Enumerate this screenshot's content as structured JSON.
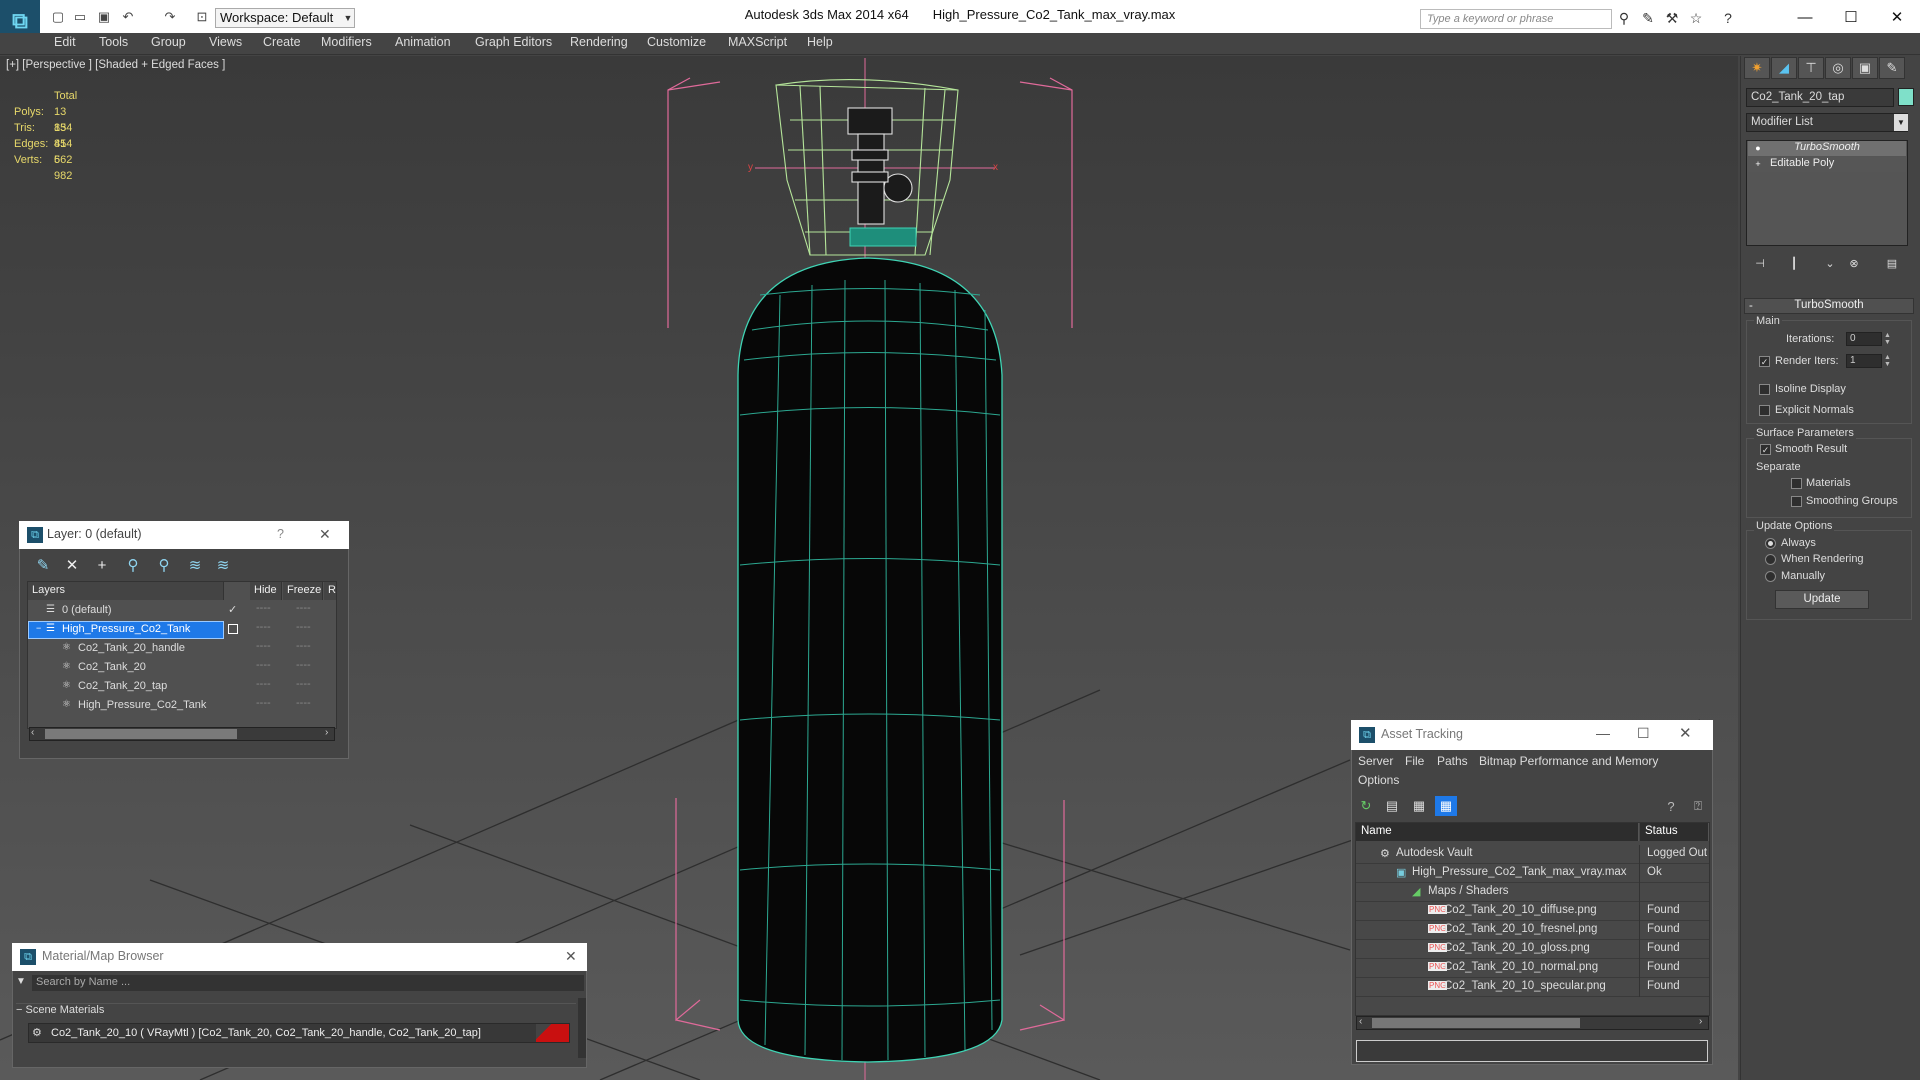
{
  "titlebar": {
    "app_title": "Autodesk 3ds Max  2014 x64",
    "file_name": "High_Pressure_Co2_Tank_max_vray.max",
    "workspace": "Workspace: Default",
    "search_placeholder": "Type a keyword or phrase"
  },
  "menu": [
    "Edit",
    "Tools",
    "Group",
    "Views",
    "Create",
    "Modifiers",
    "Animation",
    "Graph Editors",
    "Rendering",
    "Customize",
    "MAXScript",
    "Help"
  ],
  "viewport": {
    "label": "[+] [Perspective ] [Shaded + Edged Faces ]",
    "stats": {
      "header": "Total",
      "rows": [
        {
          "k": "Polys:",
          "v": "13 854"
        },
        {
          "k": "Tris:",
          "v": "13 854"
        },
        {
          "k": "Edges:",
          "v": "41 562"
        },
        {
          "k": "Verts:",
          "v": "6 982"
        }
      ]
    }
  },
  "command_panel": {
    "object_name": "Co2_Tank_20_tap",
    "object_color": "#7fe0c9",
    "modifier_list": "Modifier List",
    "stack": [
      "TurboSmooth",
      "Editable Poly"
    ],
    "rollout": "TurboSmooth",
    "main_group": "Main",
    "iterations_label": "Iterations:",
    "iterations_value": "0",
    "render_iters_label": "Render Iters:",
    "render_iters_value": "1",
    "isoline": "Isoline Display",
    "explicit_normals": "Explicit Normals",
    "surface_group": "Surface Parameters",
    "smooth_result": "Smooth Result",
    "separate": "Separate",
    "materials": "Materials",
    "smoothing_groups": "Smoothing Groups",
    "update_group": "Update Options",
    "always": "Always",
    "when_rendering": "When Rendering",
    "manually": "Manually",
    "update_button": "Update"
  },
  "layer_dialog": {
    "title": "Layer: 0 (default)",
    "help": "?",
    "col_layers": "Layers",
    "col_hide": "Hide",
    "col_freeze": "Freeze",
    "col_r": "R",
    "rows": [
      {
        "name": "0 (default)",
        "indent": 0
      },
      {
        "name": "High_Pressure_Co2_Tank",
        "indent": 1
      },
      {
        "name": "Co2_Tank_20_handle",
        "indent": 2
      },
      {
        "name": "Co2_Tank_20",
        "indent": 2
      },
      {
        "name": "Co2_Tank_20_tap",
        "indent": 2
      },
      {
        "name": "High_Pressure_Co2_Tank",
        "indent": 2
      }
    ]
  },
  "material_browser": {
    "title": "Material/Map Browser",
    "search_placeholder": "Search by Name ...",
    "group": "Scene Materials",
    "material": "Co2_Tank_20_10  ( VRayMtl )  [Co2_Tank_20, Co2_Tank_20_handle, Co2_Tank_20_tap]",
    "swatch_color": "#c91010"
  },
  "asset_tracking": {
    "title": "Asset Tracking",
    "menu": [
      "Server",
      "File",
      "Paths",
      "Bitmap Performance and Memory",
      "Options"
    ],
    "col_name": "Name",
    "col_status": "Status",
    "rows": [
      {
        "name": "Autodesk Vault",
        "status": "Logged Out",
        "indent": 0
      },
      {
        "name": "High_Pressure_Co2_Tank_max_vray.max",
        "status": "Ok",
        "indent": 1
      },
      {
        "name": "Maps / Shaders",
        "status": "",
        "indent": 2
      },
      {
        "name": "Co2_Tank_20_10_diffuse.png",
        "status": "Found",
        "indent": 3
      },
      {
        "name": "Co2_Tank_20_10_fresnel.png",
        "status": "Found",
        "indent": 3
      },
      {
        "name": "Co2_Tank_20_10_gloss.png",
        "status": "Found",
        "indent": 3
      },
      {
        "name": "Co2_Tank_20_10_normal.png",
        "status": "Found",
        "indent": 3
      },
      {
        "name": "Co2_Tank_20_10_specular.png",
        "status": "Found",
        "indent": 3
      }
    ]
  }
}
